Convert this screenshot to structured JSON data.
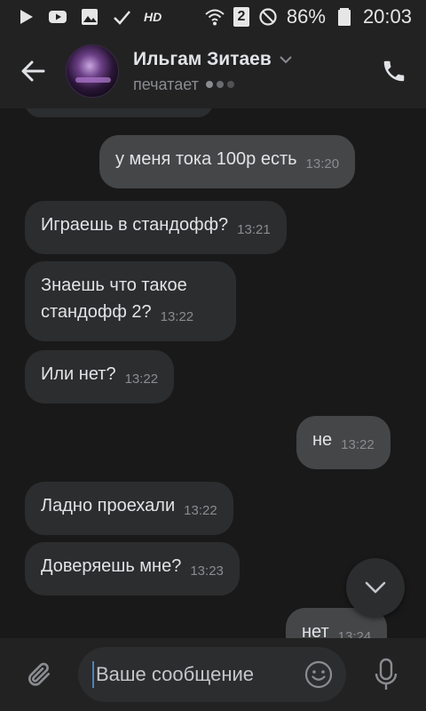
{
  "status_bar": {
    "hd_label": "HD",
    "sim_number": "2",
    "battery": "86%",
    "time": "20:03"
  },
  "header": {
    "name": "Ильгам Зитаев",
    "status": "печатает"
  },
  "messages": [
    {
      "text": "у меня тока 100р есть",
      "time": "13:20",
      "dir": "out"
    },
    {
      "text": "Играешь в стандофф?",
      "time": "13:21",
      "dir": "in"
    },
    {
      "text": "Знаешь что такое\nстандофф 2?",
      "time": "13:22",
      "dir": "in"
    },
    {
      "text": "Или нет?",
      "time": "13:22",
      "dir": "in"
    },
    {
      "text": "не",
      "time": "13:22",
      "dir": "out"
    },
    {
      "text": "Ладно проехали",
      "time": "13:22",
      "dir": "in"
    },
    {
      "text": "Доверяешь мне?",
      "time": "13:23",
      "dir": "in"
    },
    {
      "text": "нет",
      "time": "13:24",
      "dir": "out"
    }
  ],
  "composer": {
    "placeholder": "Ваше сообщение"
  },
  "colors": {
    "background": "#19191a",
    "bar": "#222223",
    "incoming_bubble": "#2c2d2e",
    "outgoing_bubble": "#454647",
    "accent": "#5181b8"
  }
}
